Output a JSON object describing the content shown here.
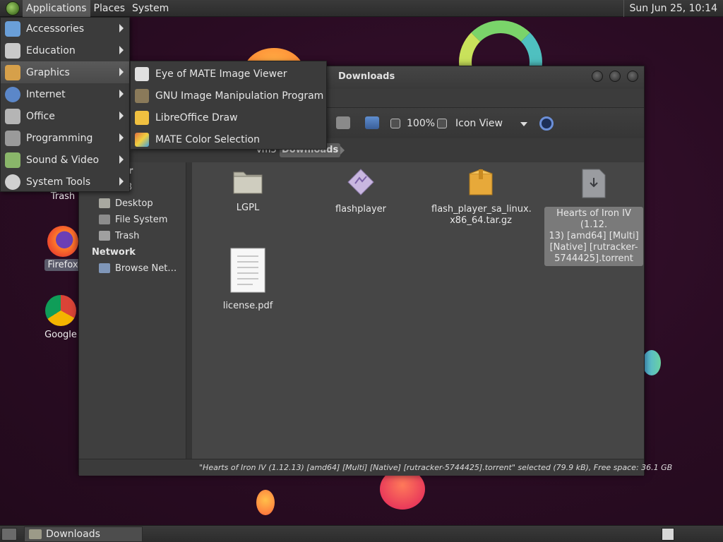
{
  "top_panel": {
    "menus": [
      "Applications",
      "Places",
      "System"
    ],
    "clock": "Sun Jun 25, 10:14"
  },
  "app_menu": {
    "items": [
      {
        "label": "Accessories",
        "icon": "accessories-icon",
        "color": "#6a9fd8"
      },
      {
        "label": "Education",
        "icon": "education-icon",
        "color": "#c9c9c9"
      },
      {
        "label": "Graphics",
        "icon": "graphics-icon",
        "color": "#d6a04a"
      },
      {
        "label": "Internet",
        "icon": "internet-icon",
        "color": "#5b87c9"
      },
      {
        "label": "Office",
        "icon": "office-icon",
        "color": "#b5b5b5"
      },
      {
        "label": "Programming",
        "icon": "programming-icon",
        "color": "#9a9a9a"
      },
      {
        "label": "Sound & Video",
        "icon": "sound-video-icon",
        "color": "#8ab66a"
      },
      {
        "label": "System Tools",
        "icon": "system-tools-icon",
        "color": "#d0d0d0"
      }
    ],
    "active_index": 2
  },
  "graphics_submenu": {
    "items": [
      {
        "label": "Eye of MATE Image Viewer",
        "icon": "image-viewer-icon",
        "color": "#e0e0e0"
      },
      {
        "label": "GNU Image Manipulation Program",
        "icon": "gimp-icon",
        "color": "#8a7a5a"
      },
      {
        "label": "LibreOffice Draw",
        "icon": "libreoffice-draw-icon",
        "color": "#f0c040"
      },
      {
        "label": "MATE Color Selection",
        "icon": "color-selection-icon",
        "color": "#e07040"
      }
    ]
  },
  "desktop": {
    "icons": [
      {
        "label": "Trash",
        "icon": "trash-icon"
      },
      {
        "label": "Firefox",
        "icon": "firefox-icon"
      },
      {
        "label": "Google",
        "icon": "chrome-icon"
      }
    ]
  },
  "file_manager": {
    "title": "Downloads",
    "toolbar": {
      "zoom": "100%",
      "view_mode": "Icon View"
    },
    "location": {
      "crumbs": [
        "vm3",
        "Downloads"
      ]
    },
    "sidebar": {
      "partial_header": "er",
      "partial_item": "3",
      "items": [
        {
          "label": "Desktop",
          "icon": "desktop-folder-icon"
        },
        {
          "label": "File System",
          "icon": "filesystem-icon"
        },
        {
          "label": "Trash",
          "icon": "trash-icon"
        }
      ],
      "network_header": "Network",
      "network_items": [
        {
          "label": "Browse Net…",
          "icon": "network-icon"
        }
      ]
    },
    "files": [
      {
        "name": "LGPL",
        "type": "folder"
      },
      {
        "name": "flashplayer",
        "type": "executable"
      },
      {
        "name": "flash_player_sa_linux.x86_64.tar.gz",
        "line1": "flash_player_sa_linux.",
        "line2": "x86_64.tar.gz",
        "type": "archive"
      },
      {
        "name": "Hearts of Iron IV (1.12.13) [amd64] [Multi] [Native] [rutracker-5744425].torrent",
        "lines": [
          "Hearts of Iron IV (1.12.",
          "13) [amd64] [Multi]",
          "[Native] [rutracker-",
          "5744425].torrent"
        ],
        "type": "torrent",
        "selected": true
      },
      {
        "name": "license.pdf",
        "type": "pdf"
      }
    ],
    "status": "\"Hearts of Iron IV (1.12.13) [amd64] [Multi] [Native] [rutracker-5744425].torrent\" selected (79.9 kB), Free space: 36.1 GB"
  },
  "bottom_panel": {
    "task": "Downloads"
  },
  "colors": {
    "panel": "#333333",
    "menu_bg": "#3b3b3b",
    "menu_active": "#555555",
    "desktop": "#2b0e24",
    "selection": "#7a7a7a"
  }
}
